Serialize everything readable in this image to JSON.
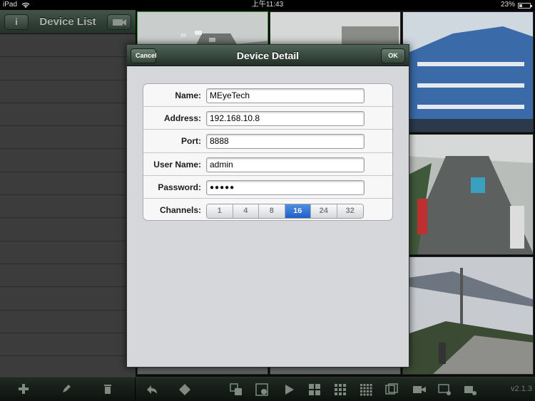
{
  "status_bar": {
    "device": "iPad",
    "time": "上午11:43",
    "battery": "23%",
    "battery_level": 0.23
  },
  "sidebar": {
    "title": "Device List",
    "info_label": "i",
    "rows": 15
  },
  "modal": {
    "title": "Device Detail",
    "cancel_label": "Cancel",
    "ok_label": "OK",
    "fields": {
      "name_label": "Name:",
      "name_value": "MEyeTech",
      "address_label": "Address:",
      "address_value": "192.168.10.8",
      "port_label": "Port:",
      "port_value": "8888",
      "username_label": "User Name:",
      "username_value": "admin",
      "password_label": "Password:",
      "password_value": "●●●●●",
      "channels_label": "Channels:"
    },
    "channels": [
      "1",
      "4",
      "8",
      "16",
      "24",
      "32"
    ],
    "selected_channel": "16"
  },
  "toolbar": {
    "version": "v2.1.3",
    "left_icons": [
      "plus-icon",
      "pencil-icon",
      "trash-icon"
    ],
    "right_icons": [
      "back-arrow-icon",
      "ptz-icon",
      "layout-icon",
      "snapshot-icon",
      "play-icon",
      "grid-4-icon",
      "grid-9-icon",
      "grid-16-icon",
      "fullscreen-icon",
      "record-icon",
      "playback-icon",
      "camera-icon"
    ]
  },
  "colors": {
    "accent_blue": "#2f6fd6",
    "header_green": "#2f3f35",
    "active_cell": "#3a9a3a"
  }
}
